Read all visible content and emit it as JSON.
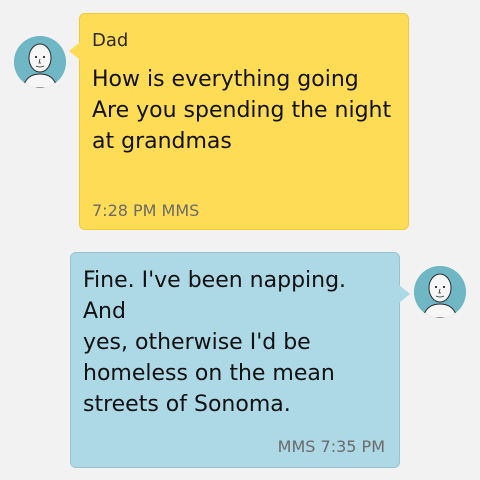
{
  "conversation": {
    "messages": [
      {
        "direction": "incoming",
        "sender": "Dad",
        "text": "How is everything going\nAre you spending the night\nat grandmas",
        "meta": "7:28 PM MMS",
        "avatar_icon": "person-avatar-icon"
      },
      {
        "direction": "outgoing",
        "text": "Fine. I've been napping. And\nyes, otherwise I'd be\nhomeless on the mean\nstreets of Sonoma.",
        "meta": "MMS 7:35 PM",
        "avatar_icon": "person-avatar-icon"
      }
    ]
  },
  "colors": {
    "incoming_bubble": "#fedc56",
    "outgoing_bubble": "#add8e6",
    "avatar_bg": "#6fb7c4",
    "background": "#f2f2f2"
  }
}
